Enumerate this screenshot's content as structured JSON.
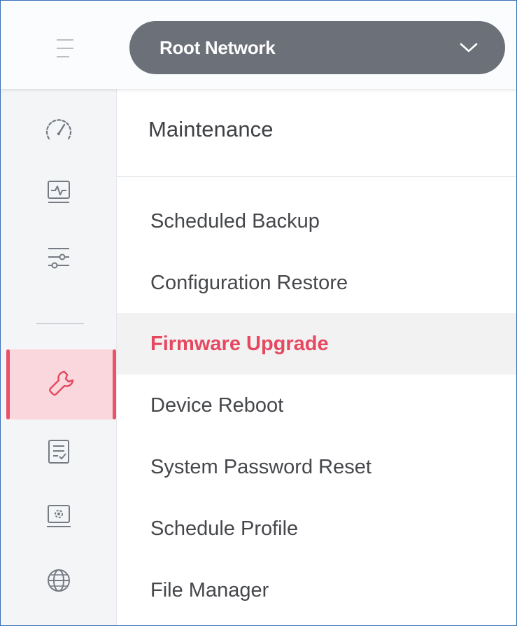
{
  "header": {
    "network_select": {
      "selected": "Root Network"
    }
  },
  "rail": {
    "items": [
      {
        "icon": "dashboard-gauge-icon"
      },
      {
        "icon": "monitoring-icon"
      },
      {
        "icon": "settings-sliders-icon"
      },
      {
        "icon": "maintenance-wrench-icon",
        "active": true
      },
      {
        "icon": "log-checklist-icon"
      },
      {
        "icon": "system-tools-icon"
      },
      {
        "icon": "globe-icon"
      }
    ]
  },
  "submenu": {
    "title": "Maintenance",
    "items": [
      {
        "label": "Scheduled Backup"
      },
      {
        "label": "Configuration Restore"
      },
      {
        "label": "Firmware Upgrade",
        "active": true
      },
      {
        "label": "Device Reboot"
      },
      {
        "label": "System Password Reset"
      },
      {
        "label": "Schedule Profile"
      },
      {
        "label": "File Manager"
      }
    ]
  },
  "colors": {
    "accent": "#e5485f",
    "active_bg": "#f9d7dc",
    "select_bg": "#6b7079"
  }
}
